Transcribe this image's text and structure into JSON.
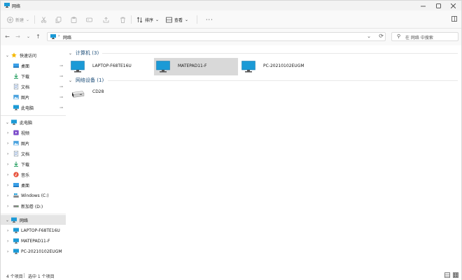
{
  "window": {
    "title": "网络"
  },
  "toolbar": {
    "new_label": "新建",
    "sort_label": "排序",
    "view_label": "查看",
    "more_label": "···",
    "details_label": "详细信息"
  },
  "address": {
    "crumb": "网络",
    "search_placeholder": "在 网络 中搜索"
  },
  "sidebar": {
    "quick_access": {
      "label": "快速访问",
      "items": [
        {
          "label": "桌面",
          "icon": "desktop-folder-icon"
        },
        {
          "label": "下载",
          "icon": "download-folder-icon"
        },
        {
          "label": "文档",
          "icon": "documents-folder-icon"
        },
        {
          "label": "图片",
          "icon": "pictures-folder-icon"
        },
        {
          "label": "此电脑",
          "icon": "this-pc-icon"
        }
      ]
    },
    "this_pc": {
      "label": "此电脑",
      "items": [
        {
          "label": "视频",
          "icon": "videos-folder-icon"
        },
        {
          "label": "图片",
          "icon": "pictures-folder-icon"
        },
        {
          "label": "文档",
          "icon": "documents-folder-icon"
        },
        {
          "label": "下载",
          "icon": "download-folder-icon"
        },
        {
          "label": "音乐",
          "icon": "music-folder-icon"
        },
        {
          "label": "桌面",
          "icon": "desktop-folder-icon"
        },
        {
          "label": "Windows (C:)",
          "icon": "drive-c-icon"
        },
        {
          "label": "新加卷 (D:)",
          "icon": "drive-d-icon"
        }
      ]
    },
    "network": {
      "label": "网络",
      "items": [
        {
          "label": "LAPTOP-F68TE16U",
          "icon": "computer-icon"
        },
        {
          "label": "MATEPAD11-F",
          "icon": "computer-icon"
        },
        {
          "label": "PC-20210102EUGM",
          "icon": "computer-icon"
        }
      ]
    }
  },
  "content": {
    "groups": [
      {
        "header": "计算机 (3)",
        "items": [
          {
            "label": "LAPTOP-F68TE16U",
            "selected": false
          },
          {
            "label": "MATEPAD11-F",
            "selected": true
          },
          {
            "label": "PC-20210102EUGM",
            "selected": false
          }
        ]
      },
      {
        "header": "网络设备 (1)",
        "items": [
          {
            "label": "CD28",
            "selected": false
          }
        ]
      }
    ]
  },
  "status": {
    "count": "4 个项目",
    "selected": "选中 1 个项目"
  },
  "colors": {
    "accent": "#1e4f7a",
    "monitor": "#1b9ad6",
    "selection": "#d9d9d9"
  }
}
